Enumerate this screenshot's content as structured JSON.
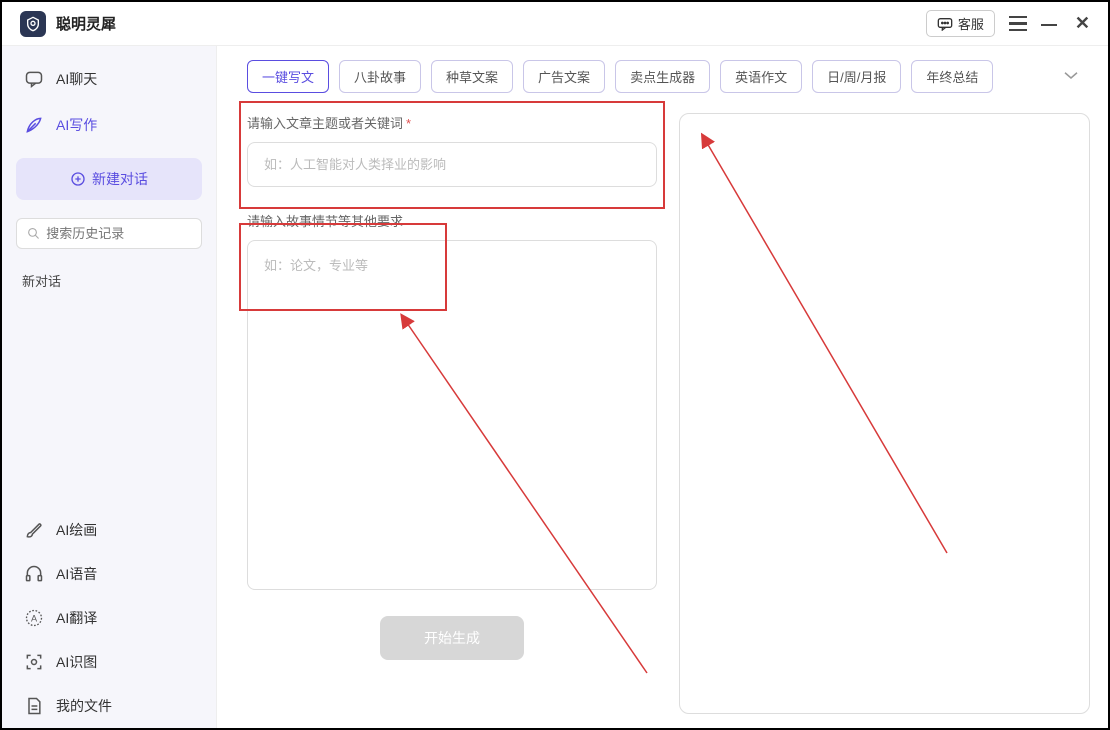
{
  "app": {
    "title": "聪明灵犀"
  },
  "titlebar": {
    "support": "客服"
  },
  "sidebar": {
    "chat": "AI聊天",
    "write": "AI写作",
    "new_chat": "新建对话",
    "search_placeholder": "搜索历史记录",
    "history_label": "新对话",
    "draw": "AI绘画",
    "voice": "AI语音",
    "translate": "AI翻译",
    "vision": "AI识图",
    "files": "我的文件"
  },
  "tabs": [
    "一键写文",
    "八卦故事",
    "种草文案",
    "广告文案",
    "卖点生成器",
    "英语作文",
    "日/周/月报",
    "年终总结"
  ],
  "form": {
    "topic_label": "请输入文章主题或者关键词",
    "topic_placeholder": "如：人工智能对人类择业的影响",
    "details_label": "请输入故事情节等其他要求",
    "details_placeholder": "如：论文，专业等",
    "generate": "开始生成"
  }
}
